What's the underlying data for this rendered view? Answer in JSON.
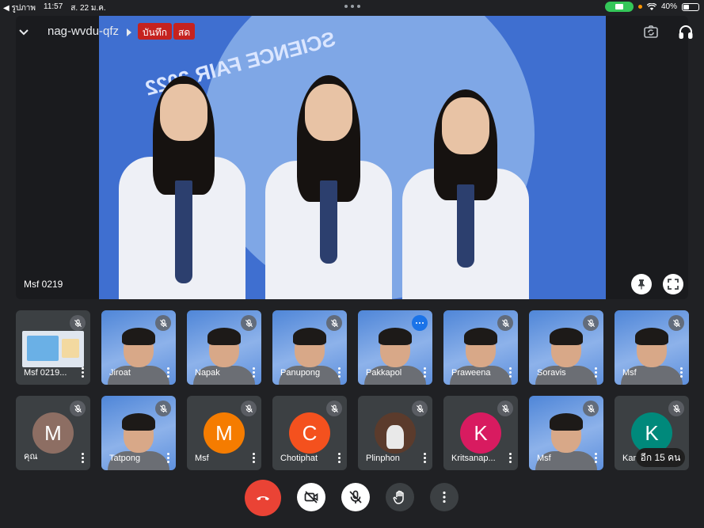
{
  "status_bar": {
    "back_app": "◀ รูปภาพ",
    "time": "11:57",
    "date": "ส. 22 ม.ค.",
    "battery": "40%",
    "battery_level": 0.4
  },
  "meeting": {
    "code": "nag-wvdu-qfz",
    "recording_badge": "บันทึก",
    "live_badge": "สด"
  },
  "main_video": {
    "name": "Msf 0219",
    "logo_text": "SCIENCE FAIR 2022"
  },
  "participants_row1": [
    {
      "name": "Msf 0219...",
      "muted": true,
      "type": "screen"
    },
    {
      "name": "Jiroat",
      "muted": true,
      "type": "video"
    },
    {
      "name": "Napak",
      "muted": true,
      "type": "video"
    },
    {
      "name": "Panupong",
      "muted": true,
      "type": "video"
    },
    {
      "name": "Pakkapol",
      "muted": false,
      "type": "video"
    },
    {
      "name": "Praweena",
      "muted": true,
      "type": "video"
    },
    {
      "name": "Soravis",
      "muted": true,
      "type": "video"
    },
    {
      "name": "Msf",
      "muted": true,
      "type": "video"
    }
  ],
  "participants_row2": [
    {
      "name": "คุณ",
      "initial": "M",
      "color": "#8d6e63",
      "type": "avatar"
    },
    {
      "name": "Tatpong",
      "type": "video"
    },
    {
      "name": "Msf",
      "initial": "M",
      "color": "#f57c00",
      "type": "avatar"
    },
    {
      "name": "Chotiphat",
      "initial": "C",
      "color": "#f4511e",
      "type": "avatar"
    },
    {
      "name": "Plinphon",
      "type": "photo"
    },
    {
      "name": "Kritsanap...",
      "initial": "K",
      "color": "#d81b60",
      "type": "avatar"
    },
    {
      "name": "Msf",
      "type": "video"
    },
    {
      "name": "Kan",
      "initial": "K",
      "color": "#00897b",
      "type": "avatar"
    }
  ],
  "more_participants": "อีก 15 คน",
  "colors": {
    "background": "#202124",
    "tile": "#3c4043",
    "end_call": "#ea4335",
    "record_badge": "#c5221f"
  }
}
